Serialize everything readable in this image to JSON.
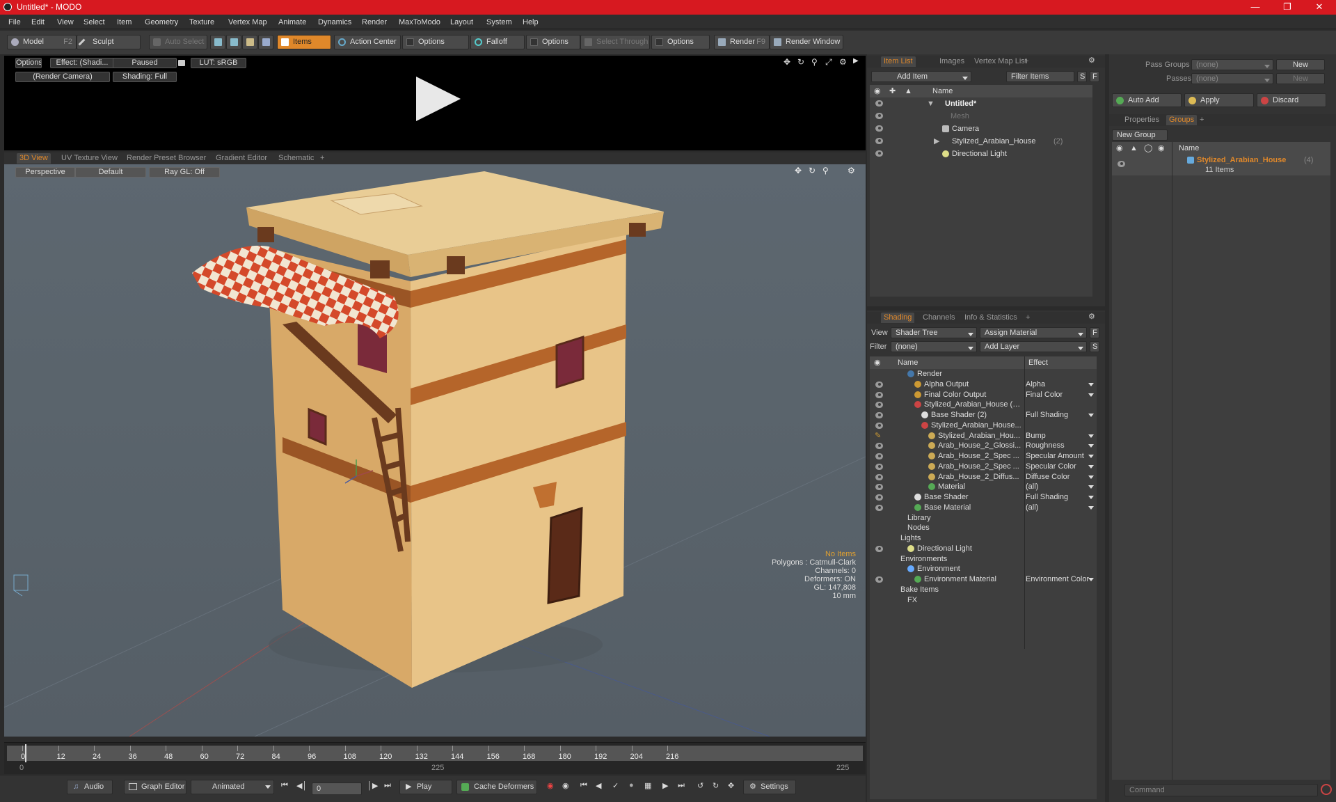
{
  "window": {
    "title": "Untitled* - MODO"
  },
  "menu": [
    "File",
    "Edit",
    "View",
    "Select",
    "Item",
    "Geometry",
    "Texture",
    "Vertex Map",
    "Animate",
    "Dynamics",
    "Render",
    "MaxToModo",
    "Layout",
    "System",
    "Help"
  ],
  "toolbar": {
    "model": "Model",
    "model_key": "F2",
    "sculpt": "Sculpt",
    "auto_select": "Auto Select",
    "items": "Items",
    "action_center": "Action Center",
    "options1": "Options",
    "falloff": "Falloff",
    "options2": "Options",
    "select_through": "Select Through",
    "options3": "Options",
    "render": "Render",
    "render_key": "F9",
    "render_window": "Render Window"
  },
  "preview": {
    "options": "Options",
    "effect": "Effect: (Shadi...",
    "paused": "Paused",
    "lut": "LUT: sRGB",
    "camera": "(Render Camera)",
    "shading": "Shading: Full"
  },
  "viewtabs": [
    "3D View",
    "UV Texture View",
    "Render Preset Browser",
    "Gradient Editor",
    "Schematic",
    "+"
  ],
  "viewport": {
    "perspective": "Perspective",
    "default": "Default",
    "raygl": "Ray GL: Off",
    "info": {
      "no_items": "No Items",
      "polygons": "Polygons : Catmull-Clark",
      "channels": "Channels: 0",
      "deformers": "Deformers: ON",
      "gl": "GL: 147,808",
      "unit": "10 mm"
    }
  },
  "timeline": {
    "ticks": [
      "0",
      "12",
      "24",
      "36",
      "48",
      "60",
      "72",
      "84",
      "96",
      "108",
      "120",
      "132",
      "144",
      "156",
      "168",
      "180",
      "192",
      "204",
      "216"
    ],
    "start": "0",
    "mid": "225",
    "end": "225"
  },
  "bottom": {
    "audio": "Audio",
    "graph_editor": "Graph Editor",
    "animated": "Animated",
    "frame": "0",
    "play": "Play",
    "cache_deformers": "Cache Deformers",
    "settings": "Settings"
  },
  "itemlist": {
    "tabs": [
      "Item List",
      "Images",
      "Vertex Map List",
      "+"
    ],
    "add_item": "Add Item",
    "filter_items": "Filter Items",
    "col_name": "Name",
    "rows": [
      {
        "label": "Untitled*"
      },
      {
        "label": "Mesh"
      },
      {
        "label": "Camera"
      },
      {
        "label": "Stylized_Arabian_House",
        "count": "(2)"
      },
      {
        "label": "Directional Light"
      }
    ]
  },
  "shading": {
    "tabs": [
      "Shading",
      "Channels",
      "Info & Statistics",
      "+"
    ],
    "view_label": "View",
    "view_value": "Shader Tree",
    "assign_material": "Assign Material",
    "filter_label": "Filter",
    "filter_value": "(none)",
    "add_layer": "Add Layer",
    "col_name": "Name",
    "col_effect": "Effect",
    "rows": [
      {
        "label": "Render",
        "effect": ""
      },
      {
        "label": "Alpha Output",
        "effect": "Alpha"
      },
      {
        "label": "Final Color Output",
        "effect": "Final Color"
      },
      {
        "label": "Stylized_Arabian_House (2...",
        "effect": ""
      },
      {
        "label": "Base Shader (2)",
        "effect": "Full Shading"
      },
      {
        "label": "Stylized_Arabian_House...",
        "effect": ""
      },
      {
        "label": "Stylized_Arabian_Hou...",
        "effect": "Bump"
      },
      {
        "label": "Arab_House_2_Glossi...",
        "effect": "Roughness"
      },
      {
        "label": "Arab_House_2_Spec ...",
        "effect": "Specular Amount"
      },
      {
        "label": "Arab_House_2_Spec ...",
        "effect": "Specular Color"
      },
      {
        "label": "Arab_House_2_Diffus...",
        "effect": "Diffuse Color"
      },
      {
        "label": "Material",
        "effect": "(all)"
      },
      {
        "label": "Base Shader",
        "effect": "Full Shading"
      },
      {
        "label": "Base Material",
        "effect": "(all)"
      },
      {
        "label": "Library",
        "effect": ""
      },
      {
        "label": "Nodes",
        "effect": ""
      },
      {
        "label": "Lights",
        "effect": ""
      },
      {
        "label": "Directional Light",
        "effect": ""
      },
      {
        "label": "Environments",
        "effect": ""
      },
      {
        "label": "Environment",
        "effect": ""
      },
      {
        "label": "Environment Material",
        "effect": "Environment Color"
      },
      {
        "label": "Bake Items",
        "effect": ""
      },
      {
        "label": "FX",
        "effect": ""
      }
    ]
  },
  "groups": {
    "pass_groups": "Pass Groups",
    "pass_value": "(none)",
    "passes": "Passes",
    "passes_value": "(none)",
    "new": "New",
    "new2": "New",
    "auto_add": "Auto Add",
    "apply": "Apply",
    "discard": "Discard",
    "tabs": [
      "Properties",
      "Groups",
      "+"
    ],
    "new_group": "New Group",
    "col_name": "Name",
    "group_name": "Stylized_Arabian_House",
    "group_count": "(4)",
    "group_items": "11 Items"
  },
  "command": {
    "placeholder": "Command"
  },
  "colors": {
    "accent": "#e0882a",
    "titlebar": "#d71920",
    "walls": "#e6c184",
    "trim": "#b5652a",
    "awning_red": "#d4492a"
  }
}
